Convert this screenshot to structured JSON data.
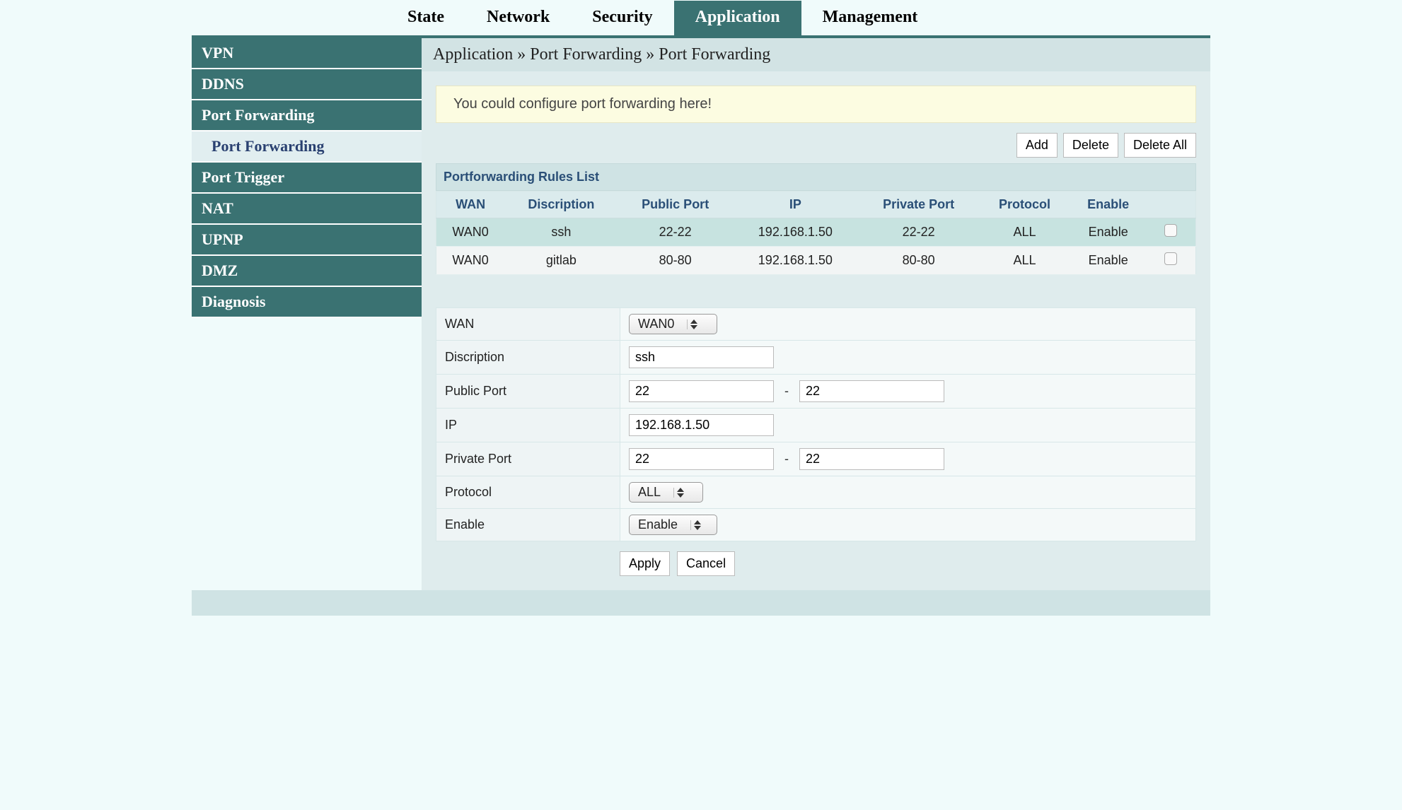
{
  "tabs": [
    {
      "label": "State"
    },
    {
      "label": "Network"
    },
    {
      "label": "Security"
    },
    {
      "label": "Application",
      "active": true
    },
    {
      "label": "Management"
    }
  ],
  "sidebar": {
    "items": [
      {
        "label": "VPN"
      },
      {
        "label": "DDNS"
      },
      {
        "label": "Port Forwarding",
        "sub": {
          "label": "Port Forwarding"
        }
      },
      {
        "label": "Port Trigger"
      },
      {
        "label": "NAT"
      },
      {
        "label": "UPNP"
      },
      {
        "label": "DMZ"
      },
      {
        "label": "Diagnosis"
      }
    ]
  },
  "breadcrumb": "Application » Port Forwarding » Port Forwarding",
  "notice": "You could configure port forwarding here!",
  "buttons": {
    "add": "Add",
    "delete": "Delete",
    "delete_all": "Delete All",
    "apply": "Apply",
    "cancel": "Cancel"
  },
  "rules": {
    "title": "Portforwarding Rules List",
    "headers": {
      "wan": "WAN",
      "desc": "Discription",
      "public": "Public Port",
      "ip": "IP",
      "private": "Private Port",
      "protocol": "Protocol",
      "enable": "Enable"
    },
    "rows": [
      {
        "wan": "WAN0",
        "desc": "ssh",
        "public": "22-22",
        "ip": "192.168.1.50",
        "private": "22-22",
        "protocol": "ALL",
        "enable": "Enable",
        "selected": true
      },
      {
        "wan": "WAN0",
        "desc": "gitlab",
        "public": "80-80",
        "ip": "192.168.1.50",
        "private": "80-80",
        "protocol": "ALL",
        "enable": "Enable",
        "selected": false
      }
    ]
  },
  "form": {
    "labels": {
      "wan": "WAN",
      "desc": "Discription",
      "public": "Public Port",
      "ip": "IP",
      "private": "Private Port",
      "protocol": "Protocol",
      "enable": "Enable"
    },
    "wan": "WAN0",
    "desc": "ssh",
    "public_start": "22",
    "public_end": "22",
    "ip": "192.168.1.50",
    "private_start": "22",
    "private_end": "22",
    "protocol": "ALL",
    "enable": "Enable"
  }
}
